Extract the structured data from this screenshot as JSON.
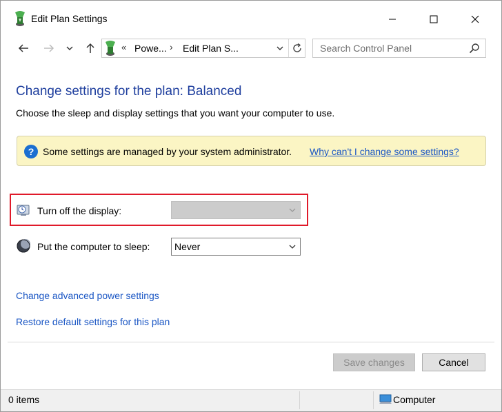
{
  "window": {
    "title": "Edit Plan Settings",
    "minimize_icon": "minimize-icon",
    "maximize_icon": "maximize-icon",
    "close_icon": "close-icon"
  },
  "nav": {
    "back_icon": "arrow-left-icon",
    "forward_icon": "arrow-right-icon",
    "recent_icon": "chevron-down-icon",
    "up_icon": "arrow-up-icon",
    "address": {
      "overflow_chevron": "«",
      "crumb1": "Powe...",
      "separator": "›",
      "crumb2": "Edit Plan S..."
    },
    "refresh_icon": "refresh-icon",
    "search": {
      "placeholder": "Search Control Panel",
      "value": ""
    }
  },
  "content": {
    "heading": "Change settings for the plan: Balanced",
    "subheading": "Choose the sleep and display settings that you want your computer to use.",
    "info": {
      "icon_text": "?",
      "message": "Some settings are managed by your system administrator.",
      "link": "Why can't I change some settings?"
    },
    "settings": [
      {
        "label": "Turn off the display:",
        "value": "",
        "disabled": true,
        "icon": "display-icon"
      },
      {
        "label": "Put the computer to sleep:",
        "value": "Never",
        "disabled": false,
        "icon": "sleep-icon"
      }
    ],
    "links": {
      "advanced": "Change advanced power settings",
      "restore": "Restore default settings for this plan"
    }
  },
  "footer": {
    "save": "Save changes",
    "cancel": "Cancel"
  },
  "status": {
    "items": "0 items",
    "location": "Computer"
  },
  "colors": {
    "heading": "#1f3f9e",
    "link": "#1a56c4",
    "info_background": "#fbf5c4",
    "highlight_border": "#e01a2a"
  }
}
